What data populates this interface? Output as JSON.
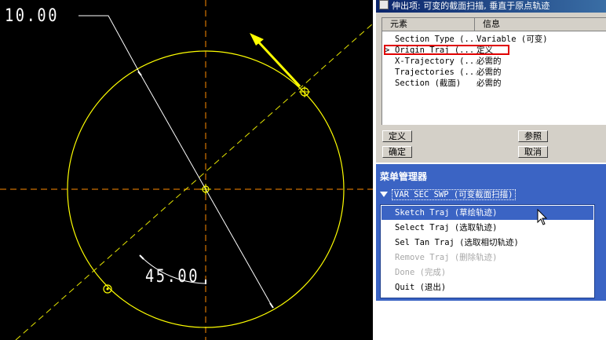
{
  "viewport": {
    "dim_radius": "10.00",
    "dim_angle": "45.00",
    "colors": {
      "background": "#000000",
      "circle": "#ffff00",
      "centerlines": "#ff8c00",
      "arrow": "#ffff00",
      "dimension": "#ffffff"
    }
  },
  "dialog": {
    "title": "伸出项: 可变的截面扫描, 垂直于原点轨迹",
    "col_element": "元素",
    "col_info": "信息",
    "rows": [
      {
        "element": "Section Type (...",
        "info": "Variable (可变)"
      },
      {
        "element": "Origin Traj (...",
        "info": "定义"
      },
      {
        "element": "X-Trajectory (...",
        "info": "必需的"
      },
      {
        "element": "Trajectories (...",
        "info": "必需的"
      },
      {
        "element": "Section (截面)",
        "info": "必需的"
      }
    ],
    "current_marker": ">",
    "buttons": {
      "define": "定义",
      "ok": "确定",
      "refs": "参照",
      "cancel": "取消"
    }
  },
  "menu_manager": {
    "title": "菜单管理器",
    "submenu": "VAR SEC SWP (可变截面扫描)",
    "items": [
      {
        "label": "Sketch Traj (草绘轨迹)",
        "selected": true,
        "disabled": false
      },
      {
        "label": "Select Traj (选取轨迹)",
        "selected": false,
        "disabled": false
      },
      {
        "label": "Sel Tan Traj (选取相切轨迹)",
        "selected": false,
        "disabled": false
      },
      {
        "label": "Remove Traj (删除轨迹)",
        "selected": false,
        "disabled": true
      },
      {
        "label": "Done (完成)",
        "selected": false,
        "disabled": true
      },
      {
        "label": "Quit (退出)",
        "selected": false,
        "disabled": false
      }
    ],
    "colors": {
      "panel": "#3b64c4",
      "selection": "#3b64c4"
    }
  }
}
